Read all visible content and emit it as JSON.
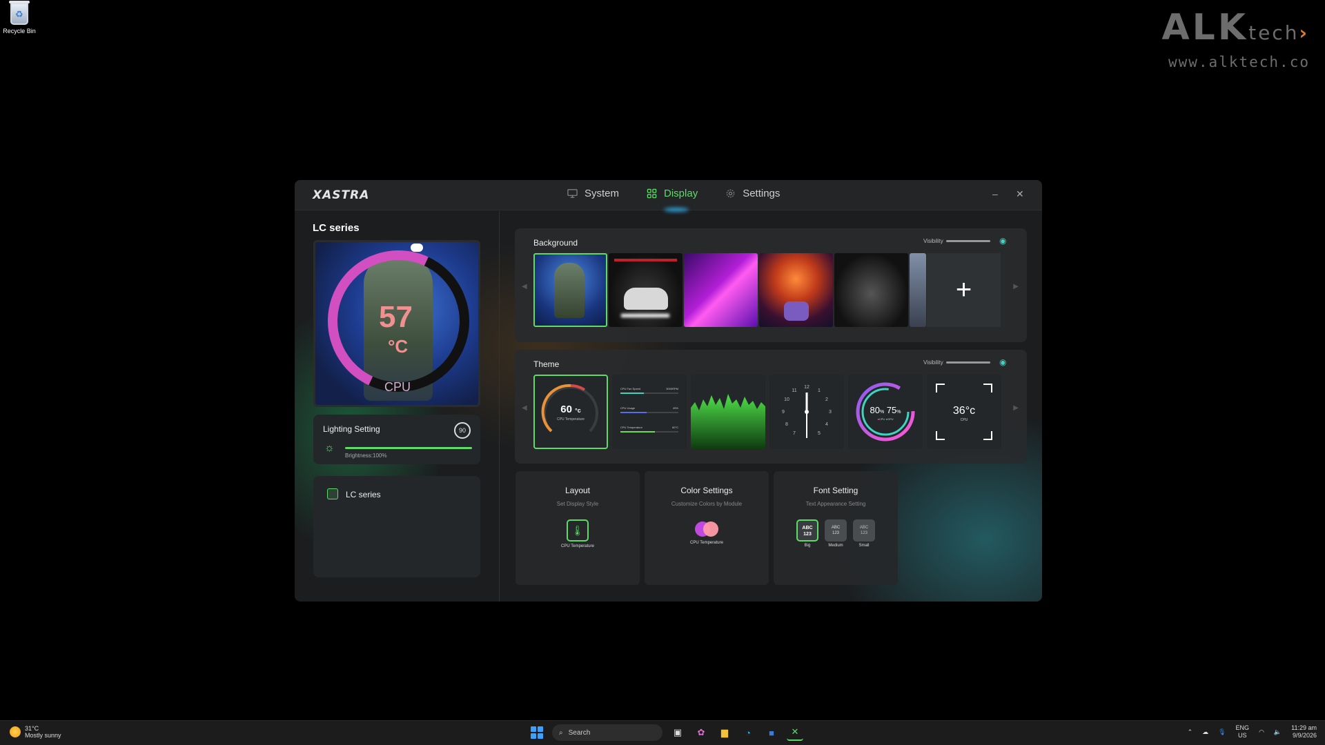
{
  "desktop": {
    "recycle_bin_label": "Recycle Bin",
    "watermark_brand": "ALK",
    "watermark_brand_suffix": "tech",
    "watermark_url": "www.alktech.co"
  },
  "app": {
    "logo": "XASTRA",
    "tabs": [
      {
        "label": "System",
        "icon": "monitor-icon"
      },
      {
        "label": "Display",
        "icon": "grid-icon"
      },
      {
        "label": "Settings",
        "icon": "gear-icon"
      }
    ],
    "active_tab": "Display",
    "accent_color": "#5ddc6a"
  },
  "left": {
    "series_title": "LC series",
    "preview": {
      "temp": "57",
      "unit": "°C",
      "label": "CPU"
    },
    "lighting": {
      "title": "Lighting Setting",
      "badge": "90",
      "brightness_label": "Brightness:100%",
      "brightness": 1.0
    },
    "device": {
      "label": "LC series"
    }
  },
  "background_panel": {
    "title": "Background",
    "visibility_label": "Visibility",
    "thumbnails": [
      "anime-soldier",
      "car-tunnel",
      "neon-beams",
      "sunset-ride",
      "black-cat",
      "partial-cat"
    ],
    "selected_index": 0
  },
  "theme_panel": {
    "title": "Theme",
    "visibility_label": "Visibility",
    "gauge": {
      "value": "60",
      "unit": "°c",
      "label": "CPU Temperature"
    },
    "bars": [
      {
        "name": "CPU Fan Speed",
        "value": "3000RPM",
        "fill": 0.4
      },
      {
        "name": "CPU Usage",
        "value": "45%",
        "fill": 0.45
      },
      {
        "name": "CPU Temperature",
        "value": "60°C",
        "fill": 0.6
      }
    ],
    "clock_numbers": [
      "12",
      "1",
      "2",
      "3",
      "4",
      "5",
      "7",
      "8",
      "9",
      "10",
      "11"
    ],
    "rings": {
      "left": "80",
      "left_unit": "%",
      "right": "75",
      "right_unit": "%",
      "legend_cpu": "CPU",
      "legend_gpu": "GPU"
    },
    "frame": {
      "value": "36°c",
      "label": "CPU"
    },
    "selected_index": 0
  },
  "bottom_cards": {
    "layout": {
      "title": "Layout",
      "subtitle": "Set Display Style",
      "item_label": "CPU Temperature"
    },
    "color": {
      "title": "Color Settings",
      "subtitle": "Customize Colors by Module",
      "item_label": "CPU Temperature"
    },
    "font": {
      "title": "Font Setting",
      "subtitle": "Text Appearance Setting",
      "options": [
        {
          "sample": "ABC\n123",
          "label": "Big"
        },
        {
          "sample": "ABC\n123",
          "label": "Medium"
        },
        {
          "sample": "ABC\n123",
          "label": "Small"
        }
      ],
      "selected": "Big"
    }
  },
  "taskbar": {
    "weather_temp": "31°C",
    "weather_desc": "Mostly sunny",
    "search_placeholder": "Search",
    "lang_top": "ENG",
    "lang_bottom": "US",
    "time": "11:29 am",
    "date": "9/9/2026"
  }
}
